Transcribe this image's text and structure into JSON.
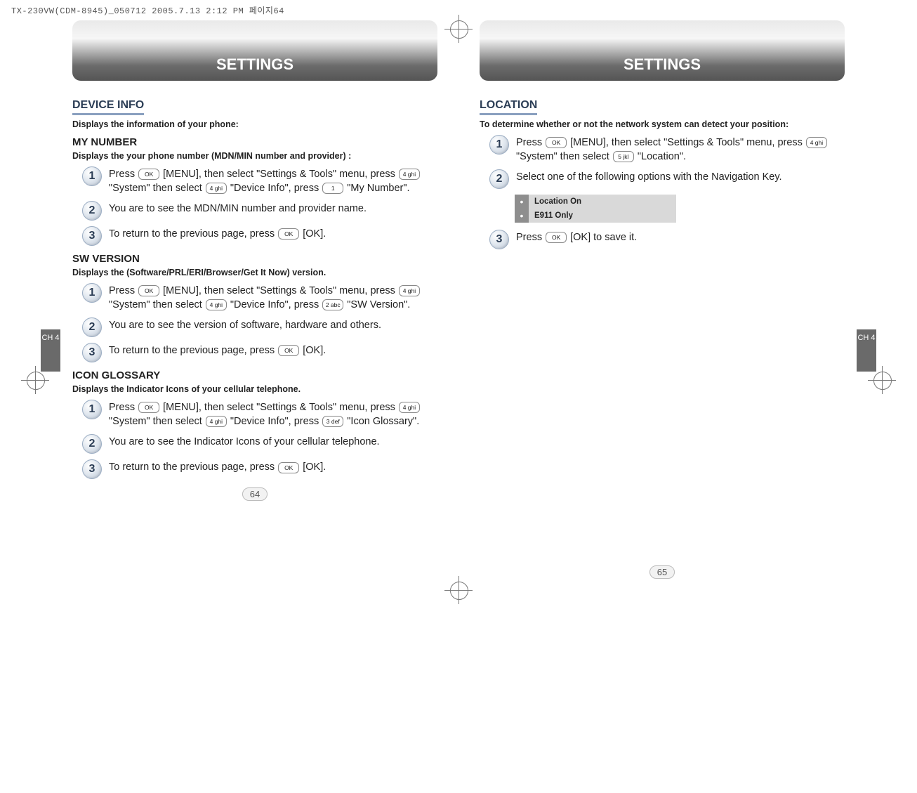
{
  "print_header": "TX-230VW(CDM-8945)_050712  2005.7.13 2:12 PM  페이지64",
  "chapter_title": "SETTINGS",
  "side_tab": "CH\n4",
  "left": {
    "device_info": {
      "title": "DEVICE INFO",
      "desc": "Displays the information of your phone:"
    },
    "my_number": {
      "title": "MY NUMBER",
      "desc": "Displays the your phone number (MDN/MIN number and provider) :",
      "steps": [
        {
          "n": "1",
          "pre1": "Press ",
          "k1": "OK",
          "mid1": " [MENU], then select \"Settings & Tools\" menu, press ",
          "k2": "4 ghi",
          "mid2": " \"System\" then select ",
          "k3": "4 ghi",
          "mid3": " \"Device Info\", press ",
          "k4": "1",
          "post": " \"My Number\"."
        },
        {
          "n": "2",
          "text": "You are to see the MDN/MIN number and provider name."
        },
        {
          "n": "3",
          "pre1": "To return to the previous page, press ",
          "k1": "OK",
          "post": " [OK]."
        }
      ]
    },
    "sw_version": {
      "title": "SW VERSION",
      "desc": "Displays the (Software/PRL/ERI/Browser/Get It Now) version.",
      "steps": [
        {
          "n": "1",
          "pre1": "Press ",
          "k1": "OK",
          "mid1": " [MENU], then select \"Settings & Tools\" menu, press ",
          "k2": "4 ghi",
          "mid2": " \"System\" then select ",
          "k3": "4 ghi",
          "mid3": " \"Device Info\", press ",
          "k4": "2 abc",
          "post": " \"SW Version\"."
        },
        {
          "n": "2",
          "text": "You are to see the version of software, hardware and others."
        },
        {
          "n": "3",
          "pre1": "To return to the previous page, press ",
          "k1": "OK",
          "post": " [OK]."
        }
      ]
    },
    "icon_glossary": {
      "title": "ICON GLOSSARY",
      "desc": "Displays the Indicator Icons of your cellular telephone.",
      "steps": [
        {
          "n": "1",
          "pre1": "Press ",
          "k1": "OK",
          "mid1": " [MENU], then select \"Settings & Tools\" menu, press ",
          "k2": "4 ghi",
          "mid2": " \"System\" then select ",
          "k3": "4 ghi",
          "mid3": " \"Device Info\", press ",
          "k4": "3 def",
          "post": " \"Icon Glossary\"."
        },
        {
          "n": "2",
          "text": "You are to see the Indicator Icons of your cellular telephone."
        },
        {
          "n": "3",
          "pre1": "To return to the previous page, press ",
          "k1": "OK",
          "post": " [OK]."
        }
      ]
    },
    "page_num": "64"
  },
  "right": {
    "location": {
      "title": "LOCATION",
      "desc": "To determine whether or not the network system can detect your position:",
      "steps": [
        {
          "n": "1",
          "pre1": "Press ",
          "k1": "OK",
          "mid1": " [MENU], then select \"Settings & Tools\" menu, press ",
          "k2": "4 ghi",
          "mid2": " \"System\" then select ",
          "k3": "5 jkl",
          "post": " \"Location\"."
        },
        {
          "n": "2",
          "text": "Select one of the following options with the Navigation Key."
        },
        {
          "n": "3",
          "pre1": "Press ",
          "k1": "OK",
          "post": " [OK] to save it."
        }
      ],
      "options": [
        "Location On",
        "E911 Only"
      ]
    },
    "page_num": "65"
  }
}
